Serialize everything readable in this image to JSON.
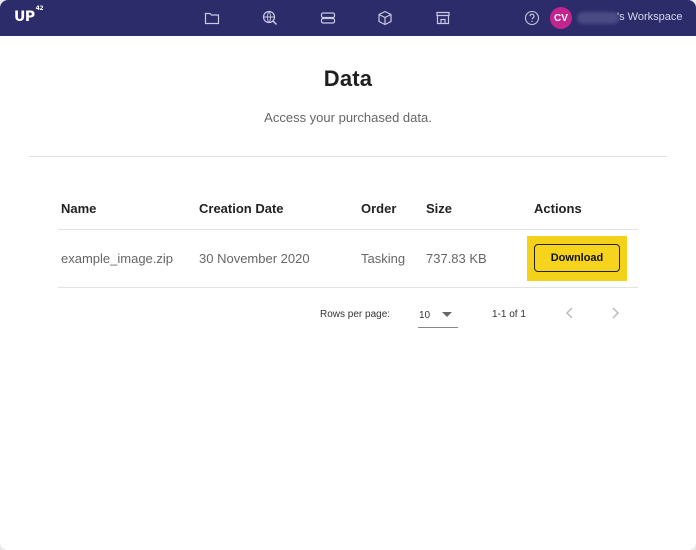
{
  "brand": {
    "logo_text": "UP",
    "logo_sup": "42"
  },
  "nav": {
    "icons": [
      "folder-icon",
      "search-globe-icon",
      "database-icon",
      "box-icon",
      "store-icon"
    ],
    "help_icon": "question-circle-icon",
    "avatar_initials": "CV",
    "workspace_suffix": "'s Workspace"
  },
  "page": {
    "title": "Data",
    "subtitle": "Access your purchased data."
  },
  "table": {
    "headers": {
      "name": "Name",
      "creation_date": "Creation Date",
      "order": "Order",
      "size": "Size",
      "actions": "Actions"
    },
    "rows": [
      {
        "name": "example_image.zip",
        "creation_date": "30 November 2020",
        "order": "Tasking",
        "size": "737.83 KB",
        "action_label": "Download"
      }
    ]
  },
  "pagination": {
    "rows_per_page_label": "Rows per page:",
    "rows_per_page_value": "10",
    "range_text": "1-1 of 1"
  },
  "colors": {
    "topbar": "#2c2c6a",
    "accent_yellow": "#f6d31c",
    "avatar": "#c4248f"
  }
}
